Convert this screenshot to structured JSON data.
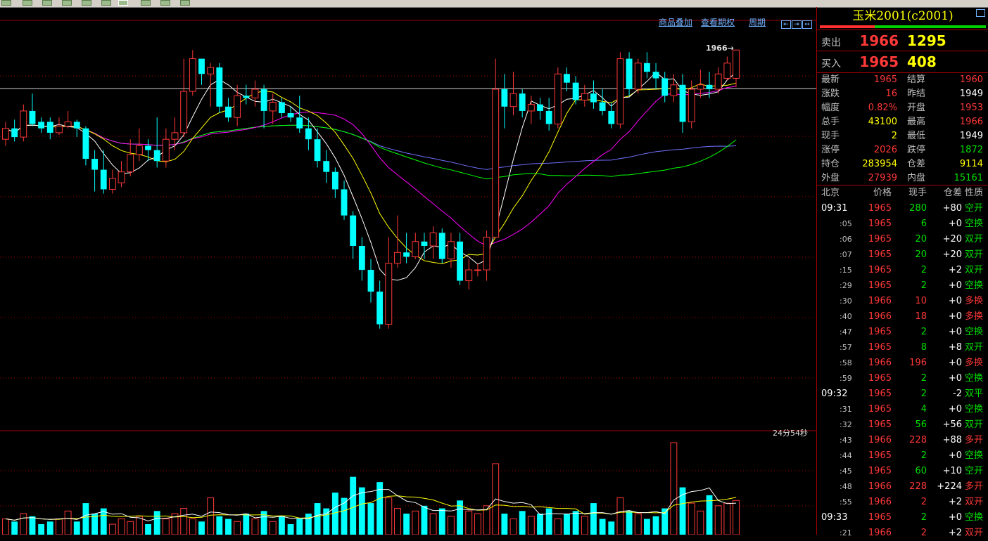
{
  "toolbar": {
    "buttons": [
      "b1",
      "b2",
      "b3",
      "b4",
      "b5",
      "b6",
      "b7",
      "b8",
      "b9",
      "b10"
    ]
  },
  "chart_links": {
    "overlay": "商品叠加",
    "options": "查看期权",
    "period": "周期"
  },
  "timer": "24分54秒",
  "last_price_tag": "1966→",
  "colors": {
    "up": "#ff3838",
    "down": "#00ffff",
    "ma5": "#ffffff",
    "ma10": "#ffff00",
    "ma20": "#ff00ff",
    "ma40": "#00ff00",
    "ma60": "#7070ff",
    "grid": "#a00000"
  },
  "panel": {
    "title": "玉米2001(c2001)",
    "sell": {
      "label": "卖出",
      "price": "1966",
      "volume": "1295"
    },
    "buy": {
      "label": "买入",
      "price": "1965",
      "volume": "408"
    },
    "stats": [
      {
        "l1": "最新",
        "v1": "1965",
        "c1": "red",
        "l2": "结算",
        "v2": "1960",
        "c2": "red"
      },
      {
        "l1": "涨跌",
        "v1": "16",
        "c1": "red",
        "l2": "昨结",
        "v2": "1949",
        "c2": "white"
      },
      {
        "l1": "幅度",
        "v1": "0.82%",
        "c1": "red",
        "l2": "开盘",
        "v2": "1953",
        "c2": "red"
      },
      {
        "l1": "总手",
        "v1": "43100",
        "c1": "yellow",
        "l2": "最高",
        "v2": "1966",
        "c2": "red"
      },
      {
        "l1": "现手",
        "v1": "2",
        "c1": "yellow",
        "l2": "最低",
        "v2": "1949",
        "c2": "white"
      },
      {
        "l1": "涨停",
        "v1": "2026",
        "c1": "red",
        "l2": "跌停",
        "v2": "1872",
        "c2": "green"
      },
      {
        "l1": "持仓",
        "v1": "283954",
        "c1": "yellow",
        "l2": "仓差",
        "v2": "9114",
        "c2": "yellow"
      },
      {
        "l1": "外盘",
        "v1": "27939",
        "c1": "red",
        "l2": "内盘",
        "v2": "15161",
        "c2": "green"
      }
    ],
    "tick_header": {
      "time": "北京",
      "price": "价格",
      "vol": "现手",
      "oi": "仓差",
      "kind": "性质"
    },
    "ticks": [
      {
        "time": "09:31",
        "price": "1965",
        "vol": "280",
        "oi": "+80",
        "kind": "空开",
        "kc": "green"
      },
      {
        "time": ":05",
        "price": "1965",
        "vol": "6",
        "oi": "+0",
        "kind": "空换",
        "kc": "green"
      },
      {
        "time": ":06",
        "price": "1965",
        "vol": "20",
        "oi": "+20",
        "kind": "双开",
        "kc": "green"
      },
      {
        "time": ":07",
        "price": "1965",
        "vol": "20",
        "oi": "+20",
        "kind": "双开",
        "kc": "green"
      },
      {
        "time": ":15",
        "price": "1965",
        "vol": "2",
        "oi": "+2",
        "kind": "双开",
        "kc": "green"
      },
      {
        "time": ":29",
        "price": "1965",
        "vol": "2",
        "oi": "+0",
        "kind": "空换",
        "kc": "green"
      },
      {
        "time": ":30",
        "price": "1966",
        "vol": "10",
        "oi": "+0",
        "kind": "多换",
        "kc": "red"
      },
      {
        "time": ":40",
        "price": "1966",
        "vol": "18",
        "oi": "+0",
        "kind": "多换",
        "kc": "red"
      },
      {
        "time": ":47",
        "price": "1965",
        "vol": "2",
        "oi": "+0",
        "kind": "空换",
        "kc": "green"
      },
      {
        "time": ":57",
        "price": "1965",
        "vol": "8",
        "oi": "+8",
        "kind": "双开",
        "kc": "green"
      },
      {
        "time": ":58",
        "price": "1966",
        "vol": "196",
        "oi": "+0",
        "kind": "多换",
        "kc": "red"
      },
      {
        "time": ":59",
        "price": "1965",
        "vol": "2",
        "oi": "+0",
        "kind": "空换",
        "kc": "green"
      },
      {
        "time": "09:32",
        "price": "1965",
        "vol": "2",
        "oi": "-2",
        "kind": "双平",
        "kc": "green"
      },
      {
        "time": ":31",
        "price": "1965",
        "vol": "4",
        "oi": "+0",
        "kind": "空换",
        "kc": "green"
      },
      {
        "time": ":32",
        "price": "1965",
        "vol": "56",
        "oi": "+56",
        "kind": "双开",
        "kc": "green"
      },
      {
        "time": ":43",
        "price": "1966",
        "vol": "228",
        "oi": "+88",
        "kind": "多开",
        "kc": "red"
      },
      {
        "time": ":44",
        "price": "1965",
        "vol": "2",
        "oi": "+0",
        "kind": "空换",
        "kc": "green"
      },
      {
        "time": ":45",
        "price": "1965",
        "vol": "60",
        "oi": "+10",
        "kind": "空开",
        "kc": "green"
      },
      {
        "time": ":48",
        "price": "1966",
        "vol": "228",
        "oi": "+224",
        "kind": "多开",
        "kc": "red"
      },
      {
        "time": ":55",
        "price": "1966",
        "vol": "2",
        "oi": "+2",
        "kind": "双开",
        "kc": "red"
      },
      {
        "time": "09:33",
        "price": "1965",
        "vol": "2",
        "oi": "+0",
        "kind": "空换",
        "kc": "green"
      },
      {
        "time": ":21",
        "price": "1966",
        "vol": "2",
        "oi": "+2",
        "kind": "双开",
        "kc": "red"
      }
    ]
  },
  "chart_data": {
    "type": "candlestick",
    "title": "",
    "last_price": 1966,
    "candles": [
      [
        1925,
        1930,
        1933,
        1922
      ],
      [
        1930,
        1926,
        1934,
        1924
      ],
      [
        1926,
        1938,
        1941,
        1924
      ],
      [
        1938,
        1932,
        1946,
        1931
      ],
      [
        1933,
        1930,
        1935,
        1928
      ],
      [
        1933,
        1928,
        1935,
        1925
      ],
      [
        1928,
        1931,
        1935,
        1927
      ],
      [
        1931,
        1933,
        1938,
        1930
      ],
      [
        1933,
        1930,
        1934,
        1926
      ],
      [
        1930,
        1916,
        1931,
        1913
      ],
      [
        1916,
        1911,
        1920,
        1901
      ],
      [
        1911,
        1902,
        1920,
        1900
      ],
      [
        1902,
        1907,
        1911,
        1900
      ],
      [
        1905,
        1910,
        1915,
        1903
      ],
      [
        1910,
        1918,
        1925,
        1908
      ],
      [
        1918,
        1922,
        1930,
        1915
      ],
      [
        1922,
        1920,
        1925,
        1915
      ],
      [
        1920,
        1915,
        1935,
        1912
      ],
      [
        1915,
        1925,
        1930,
        1912
      ],
      [
        1925,
        1928,
        1935,
        1920
      ],
      [
        1928,
        1947,
        1962,
        1926
      ],
      [
        1947,
        1962,
        1966,
        1945
      ],
      [
        1962,
        1955,
        1962,
        1950
      ],
      [
        1955,
        1958,
        1960,
        1940
      ],
      [
        1958,
        1940,
        1960,
        1937
      ],
      [
        1940,
        1935,
        1944,
        1933
      ],
      [
        1935,
        1945,
        1950,
        1931
      ],
      [
        1945,
        1944,
        1950,
        1941
      ],
      [
        1944,
        1948,
        1952,
        1940
      ],
      [
        1948,
        1938,
        1950,
        1930
      ],
      [
        1938,
        1942,
        1946,
        1932
      ],
      [
        1942,
        1937,
        1944,
        1935
      ],
      [
        1937,
        1935,
        1940,
        1933
      ],
      [
        1935,
        1930,
        1945,
        1928
      ],
      [
        1930,
        1925,
        1935,
        1920
      ],
      [
        1925,
        1915,
        1930,
        1912
      ],
      [
        1915,
        1910,
        1920,
        1905
      ],
      [
        1910,
        1902,
        1912,
        1898
      ],
      [
        1902,
        1890,
        1906,
        1888
      ],
      [
        1890,
        1876,
        1892,
        1870
      ],
      [
        1876,
        1865,
        1880,
        1860
      ],
      [
        1865,
        1855,
        1870,
        1850
      ],
      [
        1855,
        1840,
        1860,
        1838
      ],
      [
        1840,
        1868,
        1880,
        1838
      ],
      [
        1868,
        1873,
        1890,
        1866
      ],
      [
        1873,
        1871,
        1882,
        1868
      ],
      [
        1871,
        1878,
        1882,
        1870
      ],
      [
        1878,
        1876,
        1882,
        1870
      ],
      [
        1876,
        1882,
        1885,
        1870
      ],
      [
        1882,
        1870,
        1884,
        1868
      ],
      [
        1870,
        1878,
        1882,
        1866
      ],
      [
        1878,
        1860,
        1882,
        1858
      ],
      [
        1860,
        1865,
        1870,
        1856
      ],
      [
        1865,
        1865,
        1868,
        1862
      ],
      [
        1865,
        1880,
        1883,
        1860
      ],
      [
        1880,
        1948,
        1962,
        1928
      ],
      [
        1948,
        1940,
        1955,
        1930
      ],
      [
        1940,
        1946,
        1956,
        1936
      ],
      [
        1946,
        1938,
        1948,
        1935
      ],
      [
        1938,
        1941,
        1945,
        1932
      ],
      [
        1941,
        1938,
        1944,
        1934
      ],
      [
        1938,
        1932,
        1944,
        1929
      ],
      [
        1932,
        1955,
        1958,
        1930
      ],
      [
        1955,
        1951,
        1958,
        1947
      ],
      [
        1951,
        1943,
        1954,
        1941
      ],
      [
        1943,
        1946,
        1950,
        1940
      ],
      [
        1946,
        1942,
        1952,
        1939
      ],
      [
        1942,
        1938,
        1948,
        1936
      ],
      [
        1938,
        1932,
        1942,
        1930
      ],
      [
        1932,
        1962,
        1965,
        1930
      ],
      [
        1962,
        1948,
        1965,
        1945
      ],
      [
        1948,
        1960,
        1962,
        1946
      ],
      [
        1960,
        1956,
        1965,
        1953
      ],
      [
        1956,
        1953,
        1960,
        1948
      ],
      [
        1953,
        1945,
        1956,
        1942
      ],
      [
        1945,
        1950,
        1955,
        1942
      ],
      [
        1950,
        1933,
        1955,
        1928
      ],
      [
        1933,
        1948,
        1952,
        1930
      ],
      [
        1948,
        1950,
        1957,
        1944
      ],
      [
        1950,
        1948,
        1956,
        1944
      ],
      [
        1948,
        1955,
        1958,
        1946
      ],
      [
        1953,
        1960,
        1963,
        1952
      ],
      [
        1953,
        1966,
        1966,
        1949
      ]
    ],
    "volume_scale": "relative",
    "volumes": [
      6,
      5,
      8,
      7,
      4,
      5,
      6,
      9,
      5,
      12,
      8,
      10,
      4,
      6,
      5,
      7,
      4,
      9,
      6,
      8,
      10,
      6,
      5,
      14,
      7,
      6,
      5,
      8,
      6,
      9,
      5,
      7,
      4,
      6,
      8,
      12,
      10,
      16,
      14,
      22,
      18,
      12,
      20,
      14,
      10,
      8,
      9,
      11,
      8,
      10,
      7,
      13,
      9,
      8,
      11,
      27,
      8,
      6,
      9,
      7,
      8,
      10,
      6,
      8,
      9,
      7,
      12,
      6,
      5,
      14,
      9,
      8,
      6,
      7,
      10,
      35,
      18,
      12,
      9,
      15,
      11,
      12,
      13
    ]
  }
}
